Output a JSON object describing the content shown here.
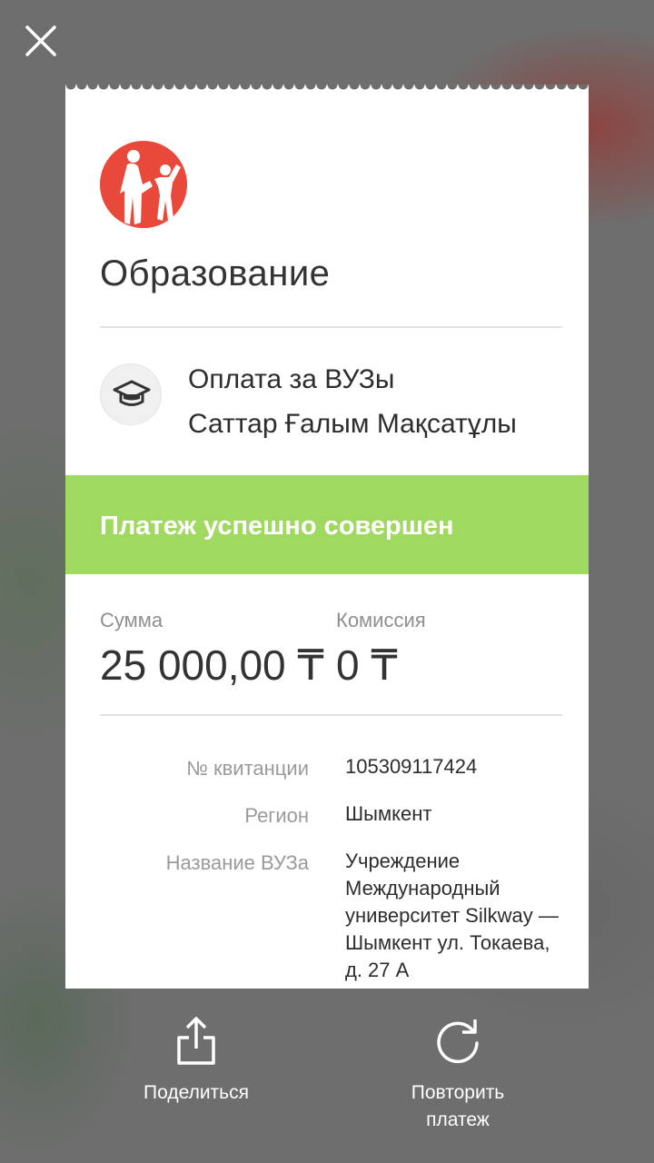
{
  "header": {
    "close_icon": "close-icon"
  },
  "receipt": {
    "logo_icon": "family-logo-icon",
    "category": "Образование",
    "service": {
      "icon": "graduation-cap-icon",
      "name": "Оплата за ВУЗы",
      "payer": "Саттар Ғалым Мақсатұлы"
    },
    "status": "Платеж успешно совершен",
    "amount": {
      "label": "Сумма",
      "value": "25 000,00 ₸"
    },
    "commission": {
      "label": "Комиссия",
      "value": "0 ₸"
    },
    "details": [
      {
        "label": "№ квитанции",
        "value": "105309117424"
      },
      {
        "label": "Регион",
        "value": "Шымкент"
      },
      {
        "label": "Название ВУЗа",
        "value": "Учреждение Международный университет Silkway — Шымкент ул. Токаева, д. 27 А"
      }
    ]
  },
  "actions": {
    "share": {
      "label": "Поделиться",
      "icon": "share-icon"
    },
    "repeat": {
      "label": "Повторить\nплатеж",
      "icon": "refresh-icon"
    }
  },
  "colors": {
    "success_green": "#9fd95f",
    "brand_red": "#e8493a",
    "overlay_gray": "#6e6e6e"
  }
}
